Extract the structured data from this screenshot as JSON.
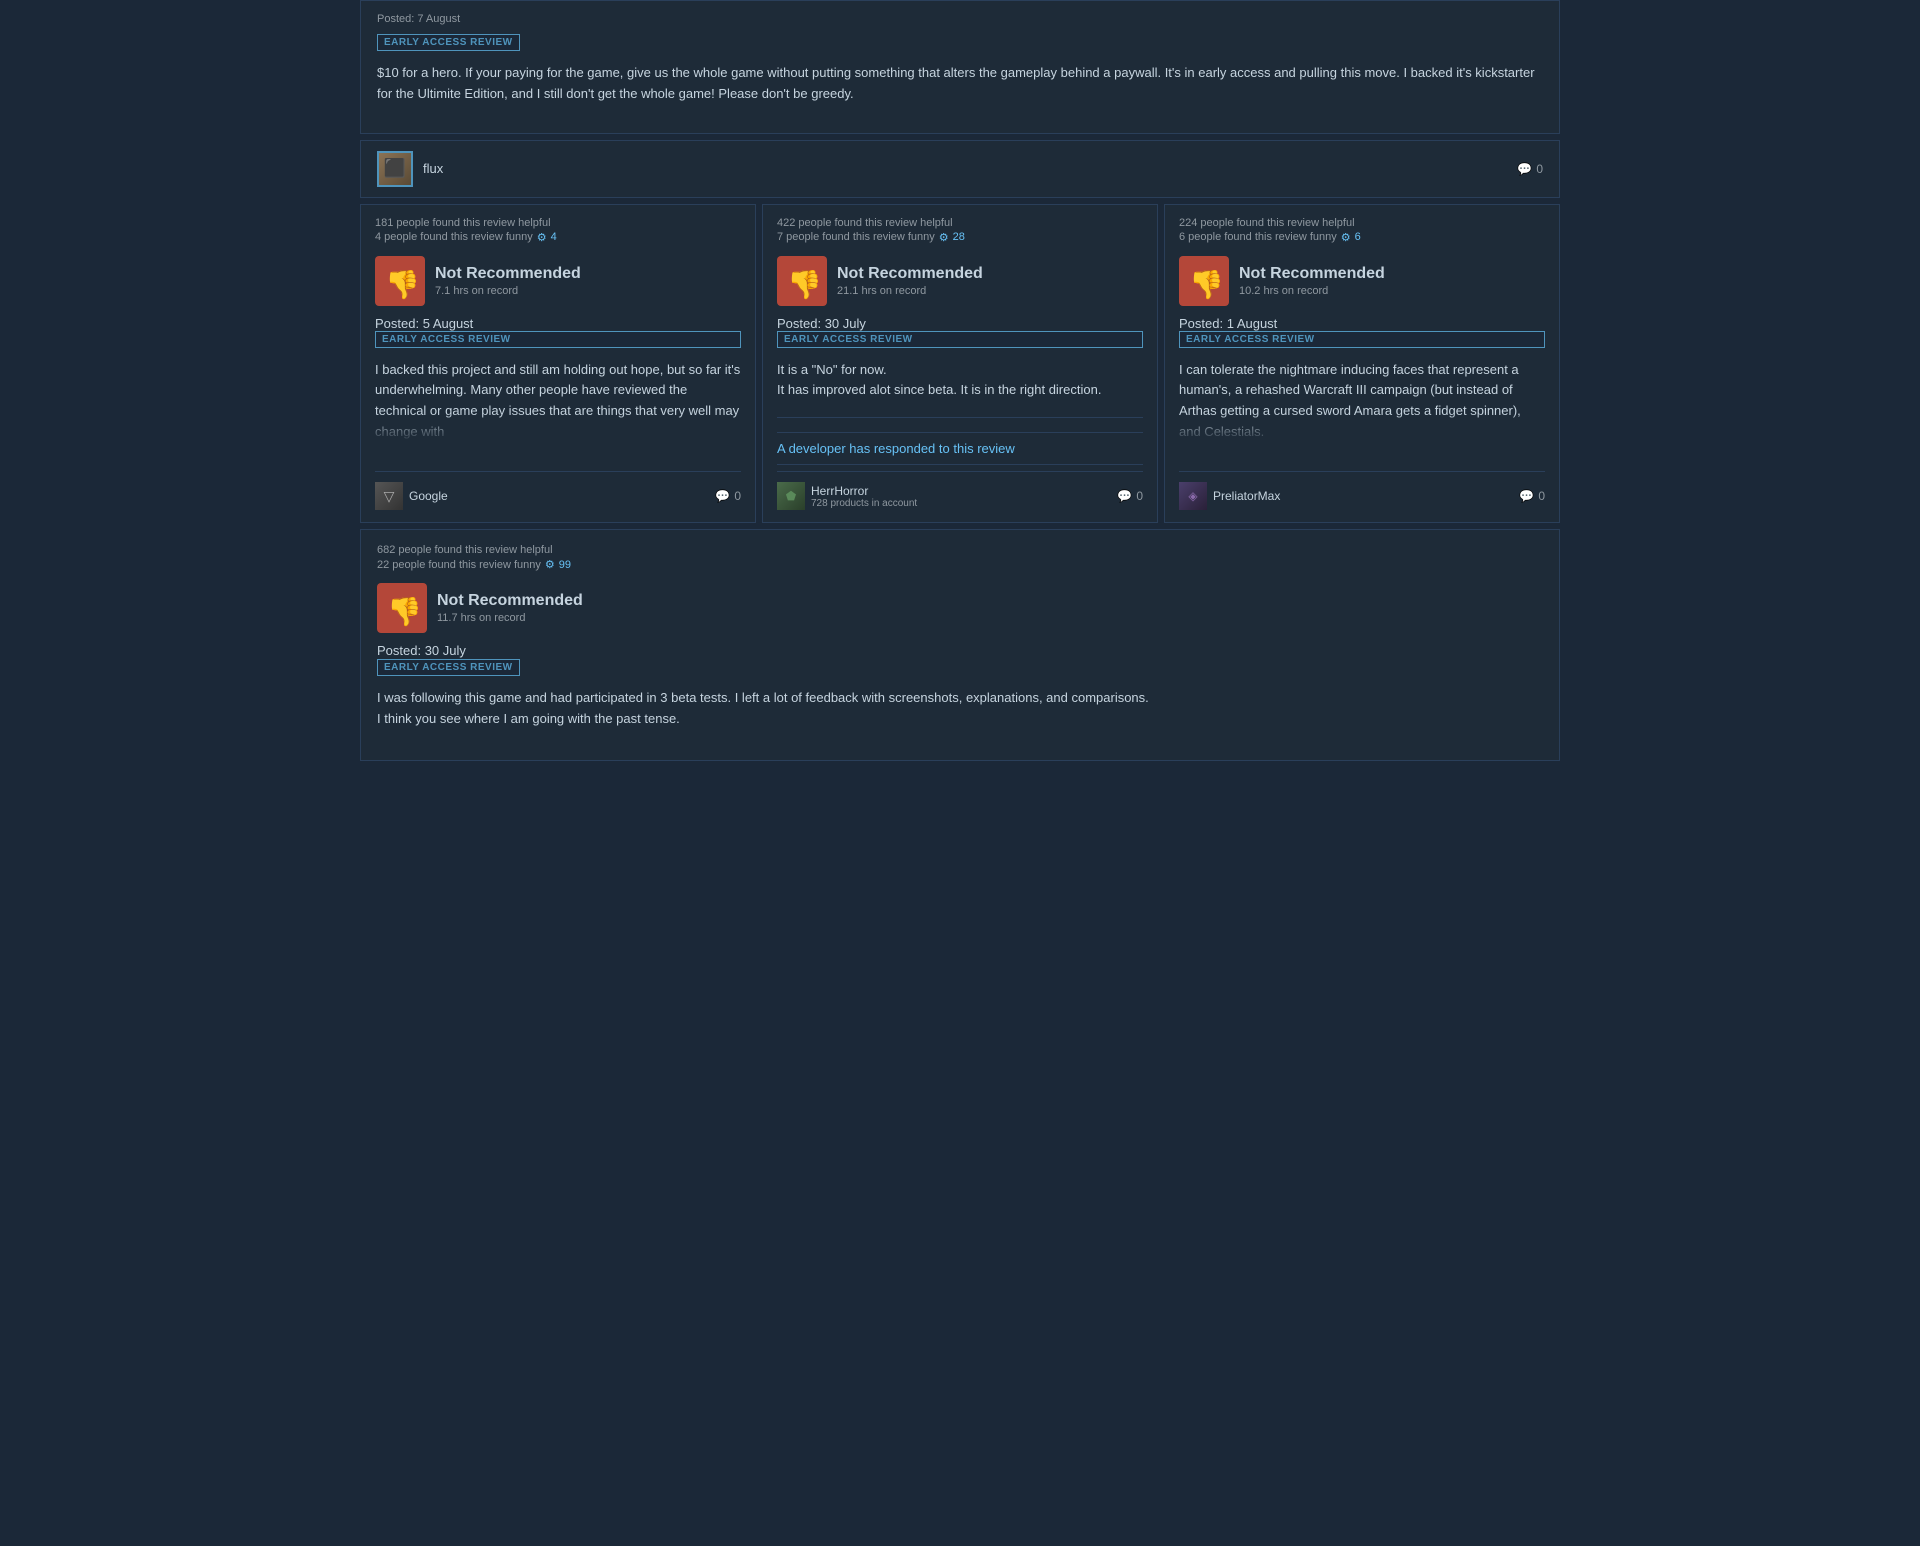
{
  "topReview": {
    "postedDate": "Posted: 7 August",
    "badge": "EARLY ACCESS REVIEW",
    "text": "$10 for a hero. If your paying for the game, give us the whole game without putting something that alters the gameplay behind a paywall. It's in early access and pulling this move. I backed it's kickstarter for the Ultimite Edition, and I still don't get the whole game! Please don't be greedy.",
    "username": "flux",
    "commentCount": "0"
  },
  "grid": {
    "cards": [
      {
        "helpfulCount": "181 people found this review helpful",
        "funnyCount": "4 people found this review funny",
        "funnyAward": "4",
        "recommendation": "Not Recommended",
        "hours": "7.1 hrs on record",
        "postedDate": "Posted: 5 August",
        "badge": "EARLY ACCESS REVIEW",
        "reviewText": "I backed this project and still am holding out hope, but so far it's underwhelming. Many other people have reviewed the technical or game play issues that are things that very well may change with",
        "username": "Google",
        "products": "",
        "commentCount": "0",
        "hasDeveloperResponse": false
      },
      {
        "helpfulCount": "422 people found this review helpful",
        "funnyCount": "7 people found this review funny",
        "funnyAward": "28",
        "recommendation": "Not Recommended",
        "hours": "21.1 hrs on record",
        "postedDate": "Posted: 30 July",
        "badge": "EARLY ACCESS REVIEW",
        "reviewText": "It is a \"No\" for now.\nIt has improved alot since beta. It is in the right direction.",
        "developerResponse": "A developer has responded to this review",
        "username": "HerrHorror",
        "products": "728 products in account",
        "commentCount": "0",
        "hasDeveloperResponse": true
      },
      {
        "helpfulCount": "224 people found this review helpful",
        "funnyCount": "6 people found this review funny",
        "funnyAward": "6",
        "recommendation": "Not Recommended",
        "hours": "10.2 hrs on record",
        "postedDate": "Posted: 1 August",
        "badge": "EARLY ACCESS REVIEW",
        "reviewText": "I can tolerate the nightmare inducing faces that represent a human's, a rehashed Warcraft III campaign (but instead of Arthas getting a cursed sword Amara gets a fidget spinner), and Celestials.",
        "username": "PreliatorMax",
        "products": "",
        "commentCount": "0",
        "hasDeveloperResponse": false
      }
    ]
  },
  "bottomReview": {
    "helpfulCount": "682 people found this review helpful",
    "funnyCount": "22 people found this review funny",
    "funnyAward": "99",
    "recommendation": "Not Recommended",
    "hours": "11.7 hrs on record",
    "postedDate": "Posted: 30 July",
    "badge": "EARLY ACCESS REVIEW",
    "text1": "I was following this game and had participated in 3 beta tests. I left a lot of feedback with screenshots, explanations, and comparisons.",
    "text2": "I think you see where I am going with the past tense."
  },
  "icons": {
    "comment": "💬",
    "award": "⚙",
    "thumbsDown": "👎"
  }
}
